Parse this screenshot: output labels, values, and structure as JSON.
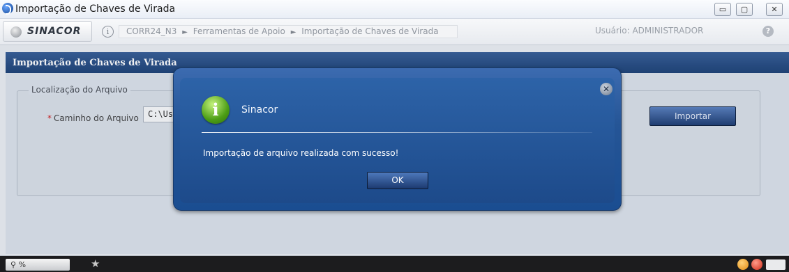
{
  "window": {
    "title": "Importação de Chaves de Virada",
    "controls": {
      "minimize": "▭",
      "maximize": "▢",
      "close": "✕"
    }
  },
  "header": {
    "logo_text": "SINACOR",
    "info_glyph": "i",
    "breadcrumb": [
      "CORR24_N3",
      "Ferramentas de Apoio",
      "Importação de Chaves de Virada"
    ],
    "breadcrumb_sep": "►",
    "user": "Usuário: ADMINISTRADOR",
    "help_glyph": "?"
  },
  "panel": {
    "title": "Importação de Chaves de Virada",
    "legend": "Localização do Arquivo",
    "required_marker": "*",
    "field_label": "Caminho do Arquivo",
    "path_value": "C:\\Us",
    "import_button": "Importar"
  },
  "modal": {
    "title": "Sinacor",
    "info_glyph": "i",
    "close_glyph": "✕",
    "message": "Importação de arquivo realizada com sucesso!",
    "ok_button": "OK"
  },
  "statusbar": {
    "zoom": "%",
    "zoom_icon": "search-icon",
    "star_glyph": "★"
  },
  "colors": {
    "header_blue": "#1f4479",
    "modal_blue": "#255596",
    "required_red": "#d21e1e"
  }
}
